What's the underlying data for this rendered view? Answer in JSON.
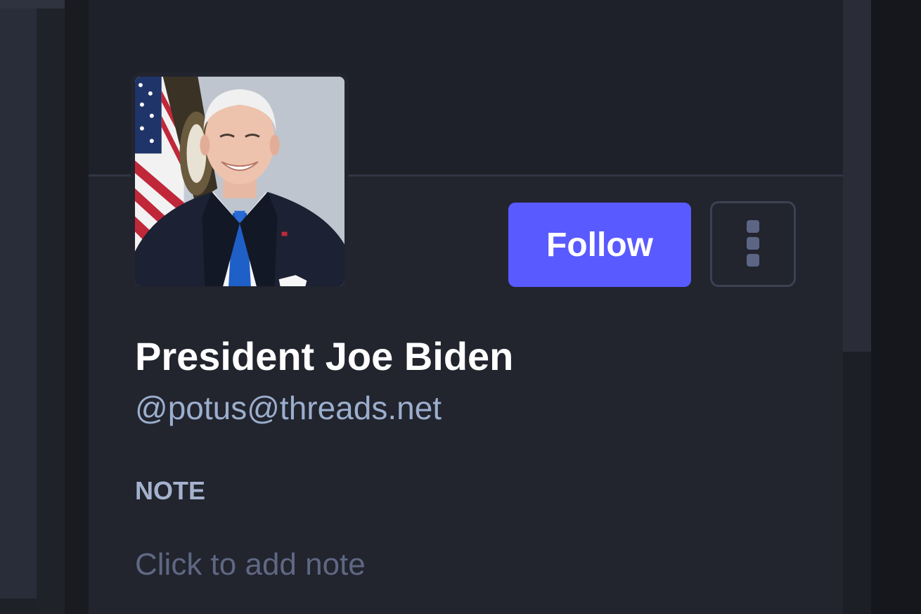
{
  "profile": {
    "display_name": "President Joe Biden",
    "handle": "@potus@threads.net",
    "avatar_alt": "avatar"
  },
  "actions": {
    "follow_label": "Follow",
    "more_icon": "vertical-ellipsis-icon"
  },
  "note": {
    "label": "NOTE",
    "placeholder": "Click to add note"
  },
  "colors": {
    "accent": "#595aff",
    "card_background": "#22242e",
    "handle_text": "#9baecd",
    "placeholder_text": "#5f6883"
  }
}
